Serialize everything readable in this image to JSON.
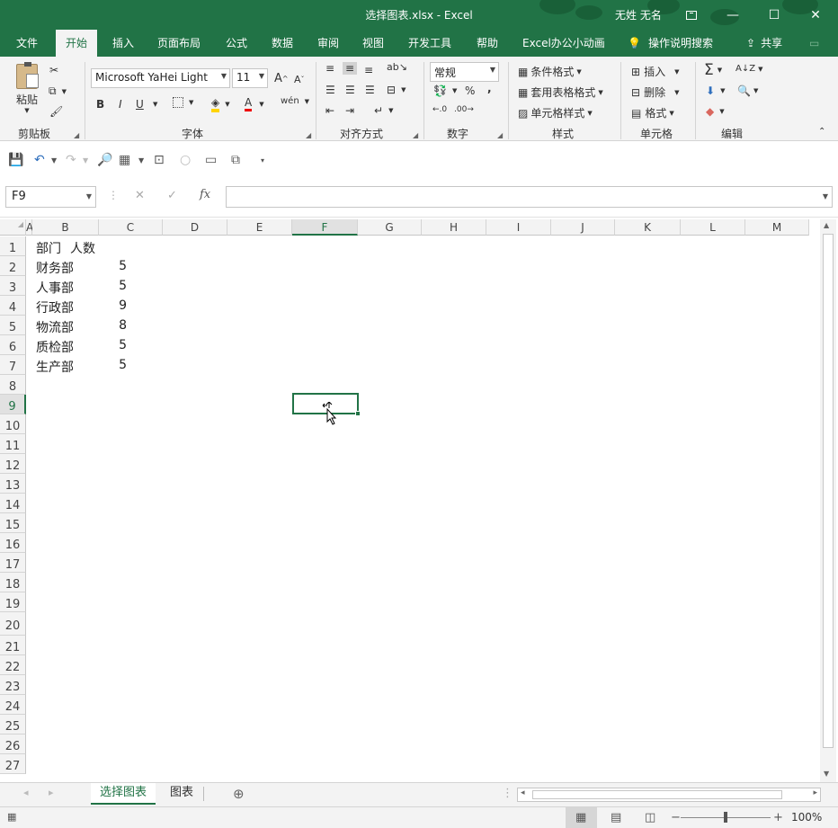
{
  "window": {
    "title": "选择图表.xlsx  -  Excel",
    "user": "无姓 无名",
    "ribbon_display_icon": "ribbon-display-icon",
    "minimize": "—",
    "maximize": "☐",
    "close": "✕"
  },
  "menu": {
    "items": [
      "文件",
      "开始",
      "插入",
      "页面布局",
      "公式",
      "数据",
      "审阅",
      "视图",
      "开发工具",
      "帮助",
      "Excel办公小动画"
    ],
    "active": "开始",
    "tell_me": "操作说明搜索",
    "share": "共享"
  },
  "ribbon": {
    "clipboard": {
      "paste": "粘贴",
      "label": "剪贴板"
    },
    "font": {
      "name": "Microsoft YaHei Light",
      "size": "11",
      "bold": "B",
      "italic": "I",
      "underline": "U",
      "grow": "A",
      "shrink": "A",
      "color": "A",
      "phonetic": "wén",
      "label": "字体"
    },
    "alignment": {
      "label": "对齐方式"
    },
    "number": {
      "format": "常规",
      "percent": "%",
      "comma": ",",
      "label": "数字"
    },
    "styles": {
      "conditional": "条件格式",
      "table": "套用表格格式",
      "cell": "单元格样式",
      "label": "样式"
    },
    "cells": {
      "insert": "插入",
      "delete": "删除",
      "format": "格式",
      "label": "单元格"
    },
    "editing": {
      "sum": "Σ",
      "label": "编辑"
    }
  },
  "formula_bar": {
    "name_box": "F9",
    "cancel": "✕",
    "enter": "✓",
    "fx": "fx",
    "value": ""
  },
  "columns": [
    "A",
    "B",
    "C",
    "D",
    "E",
    "F",
    "G",
    "H",
    "I",
    "J",
    "K",
    "L",
    "M"
  ],
  "selected_column": "F",
  "rows": [
    "1",
    "2",
    "3",
    "4",
    "5",
    "6",
    "7",
    "8",
    "9",
    "10",
    "11",
    "12",
    "13",
    "14",
    "15",
    "16",
    "17",
    "18",
    "19",
    "20",
    "21",
    "22",
    "23",
    "24",
    "25",
    "26",
    "27"
  ],
  "selected_row": "9",
  "table": {
    "headers": [
      "部门",
      "人数"
    ],
    "rows": [
      [
        "财务部",
        "5"
      ],
      [
        "人事部",
        "5"
      ],
      [
        "行政部",
        "9"
      ],
      [
        "物流部",
        "8"
      ],
      [
        "质检部",
        "5"
      ],
      [
        "生产部",
        "5"
      ]
    ]
  },
  "sheets": {
    "tabs": [
      "选择图表",
      "图表"
    ],
    "active": "选择图表",
    "add": "⊕"
  },
  "status": {
    "zoom": "100%",
    "zoom_in": "+",
    "zoom_out": "−"
  },
  "colors": {
    "accent": "#217346",
    "ribbon_bg": "#f3f3f3"
  }
}
